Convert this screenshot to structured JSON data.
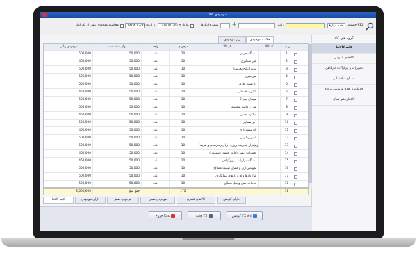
{
  "window": {
    "title": "موجودی کالا"
  },
  "toolbar": {
    "search_label": "جستجو F12",
    "group_select": "همه موارد",
    "warehouse_label": "انبار:",
    "invoice_num_label": "شماره انبارها",
    "to_date_label": "تا تاریخ:",
    "to_date": "1404/01/01",
    "from_date_label": "تا تاریخ:",
    "from_date": "1404/12/29",
    "calc_label": "محاسبه موجودی بیش از یک انبار"
  },
  "sidebar": {
    "title": "گروه های کالا",
    "items": [
      "کلیه کالاها",
      "کالاهای عمومی",
      "تجهیزات و ابزارآلات کارگاهی",
      "مصالح ساختمانی",
      "خدمات و اقلام مدیریتی پروژه",
      "کالاهای غیر فعال"
    ]
  },
  "tabs_top": [
    "خلاصه موجودی",
    "ریز موجودی"
  ],
  "columns": {
    "row": "ردیف",
    "code": "کد کالا",
    "name": "نام کالا",
    "stock": "موجودی",
    "unit": "واحد",
    "price": "بهای تمام شده",
    "value": "موجودی ریالی"
  },
  "rows": [
    {
      "row": "1",
      "code": "",
      "name": "دستگاه جوش",
      "stock": "10",
      "unit": "عدد",
      "price": "50,000",
      "value": "500,000"
    },
    {
      "row": "2",
      "code": "",
      "name": "فرز سنگبری",
      "stock": "10",
      "unit": "عدد",
      "price": "50,000",
      "value": "460,000"
    },
    {
      "row": "3",
      "code": "",
      "name": "بتونه (پکیج تخریب)",
      "stock": "10",
      "unit": "عدد",
      "price": "50,000",
      "value": "500,000"
    },
    {
      "row": "4",
      "code": "",
      "name": "فنر تیبری",
      "stock": "10",
      "unit": "عدد",
      "price": "50,000",
      "value": "500,000"
    },
    {
      "row": "5",
      "code": "",
      "name": "داربست فلزی",
      "stock": "10",
      "unit": "عدد",
      "price": "50,000",
      "value": "500,000"
    },
    {
      "row": "6",
      "code": "",
      "name": "بالابر ساختمانی",
      "stock": "10",
      "unit": "عدد",
      "price": "50,000",
      "value": "450,000"
    },
    {
      "row": "7",
      "code": "",
      "name": "سیمان تیپ 2",
      "stock": "10",
      "unit": "عدد",
      "price": "50,000",
      "value": "500,000"
    },
    {
      "row": "8",
      "code": "",
      "name": "شن و ماسه شکسته",
      "stock": "10",
      "unit": "عدد",
      "price": "50,000",
      "value": "500,000"
    },
    {
      "row": "9",
      "code": "",
      "name": "میلگرد آجدار",
      "stock": "10",
      "unit": "عدد",
      "price": "50,000",
      "value": "460,000"
    },
    {
      "row": "10",
      "code": "",
      "name": "آجر فشاری",
      "stock": "10",
      "unit": "عدد",
      "price": "50,000",
      "value": "500,000"
    },
    {
      "row": "11",
      "code": "",
      "name": "گچ سفیدکاری",
      "stock": "10",
      "unit": "عدد",
      "price": "50,000",
      "value": "460,000"
    },
    {
      "row": "12",
      "code": "",
      "name": "عایق رطوبتی",
      "stock": "10",
      "unit": "عدد",
      "price": "50,000",
      "value": "500,000"
    },
    {
      "row": "13",
      "code": "",
      "name": "نرم‌افزار مدیریت پروژه (برای زمان‌بندی و هزینه)",
      "stock": "10",
      "unit": "عدد",
      "price": "50,000",
      "value": "500,000"
    },
    {
      "row": "14",
      "code": "",
      "name": "تجهیزات ایمنی (کلاه، جلیقه، دستکش)",
      "stock": "10",
      "unit": "عدد",
      "price": "50,000",
      "value": "460,000"
    },
    {
      "row": "15",
      "code": "",
      "name": "دستگاه ترازیاب / توپوگرافی",
      "stock": "10",
      "unit": "عدد",
      "price": "50,000",
      "value": "460,000"
    },
    {
      "row": "16",
      "code": "",
      "name": "نمونه‌برداری و کنترل کیفیت مصالح",
      "stock": "10",
      "unit": "عدد",
      "price": "50,000",
      "value": "500,000"
    },
    {
      "row": "17",
      "code": "",
      "name": "قراردادها و قراردادهای پیمانکاری",
      "stock": "10",
      "unit": "عدد",
      "price": "50,000",
      "value": "500,000"
    },
    {
      "row": "18",
      "code": "",
      "name": "خدمات حمل و نقل مصالح",
      "stock": "10",
      "unit": "عدد",
      "price": "50,000",
      "value": "500,000"
    }
  ],
  "summary": {
    "count": "18",
    "total_stock": "172",
    "total_label": "جمع مبلغ",
    "total_value": "8,600,000"
  },
  "tabs_bottom": [
    "دارای گردش",
    "کالاهای کسری",
    "موجودی منفی",
    "موجودی صفر",
    "دارای موجودی",
    "کلیه کالاها"
  ],
  "buttons": {
    "turnover": "گردش F2 کالا",
    "print": "چاپ F3",
    "exit": "خروج Esc"
  }
}
